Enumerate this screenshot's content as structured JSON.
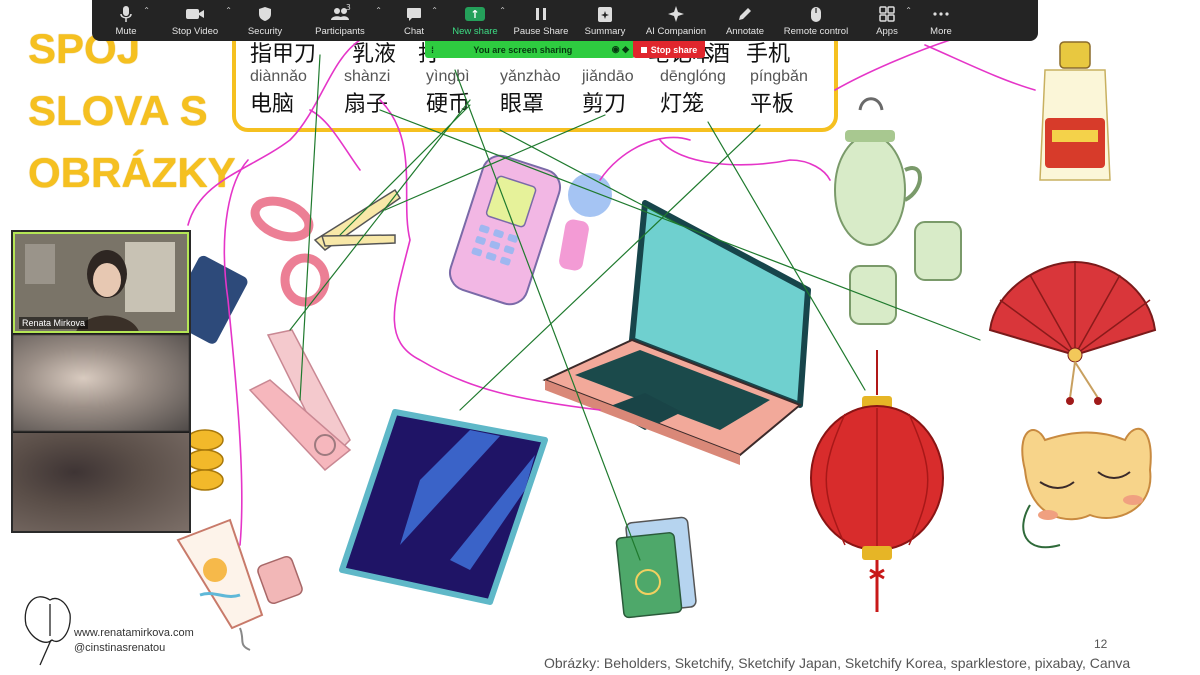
{
  "toolbar": {
    "items": [
      {
        "label": "Mute"
      },
      {
        "label": "Stop Video"
      },
      {
        "label": "Security"
      },
      {
        "label": "Participants",
        "count": "3"
      },
      {
        "label": "Chat"
      },
      {
        "label": "New share"
      },
      {
        "label": "Pause Share"
      },
      {
        "label": "Summary"
      },
      {
        "label": "AI Companion"
      },
      {
        "label": "Annotate"
      },
      {
        "label": "Remote control"
      },
      {
        "label": "Apps"
      },
      {
        "label": "More"
      }
    ]
  },
  "sharing": {
    "banner_text": "You are screen sharing",
    "stop_label": "Stop share"
  },
  "slide": {
    "title_lines": [
      "SPOJ",
      "SLOVA S",
      "OBRÁZKY"
    ],
    "words_top": [
      "指甲刀",
      "乳液",
      "打",
      "笔记本",
      "酒",
      "手机"
    ],
    "words_bottom": [
      {
        "pinyin": "diànnǎo",
        "hanzi": "电脑"
      },
      {
        "pinyin": "shànzi",
        "hanzi": "扇子"
      },
      {
        "pinyin": "yìngbì",
        "hanzi": "硬币"
      },
      {
        "pinyin": "yǎnzhào",
        "hanzi": "眼罩"
      },
      {
        "pinyin": "jiǎndāo",
        "hanzi": "剪刀"
      },
      {
        "pinyin": "dēnglóng",
        "hanzi": "灯笼"
      },
      {
        "pinyin": "píngbǎn",
        "hanzi": "平板"
      }
    ],
    "footer_web": "www.renatamirkova.com",
    "footer_handle": "@cinstinasrenatou",
    "page_number": "12",
    "credits": "Obrázky: Beholders, Sketchify, Sketchify Japan, Sketchify Korea, sparklestore, pixabay, Canva"
  },
  "participants": {
    "names": [
      "Renata Mirkova"
    ]
  },
  "colors": {
    "title": "#f5c020",
    "toolbar_bg": "#242424",
    "share_green": "#2ecc40",
    "stop_red": "#e0262d",
    "annotation_magenta": "#e535c8",
    "annotation_green": "#1f7a2e"
  },
  "icons": [
    "mic-icon",
    "video-icon",
    "shield-icon",
    "participants-icon",
    "chat-icon",
    "new-share-icon",
    "pause-icon",
    "summary-icon",
    "ai-sparkle-icon",
    "pen-icon",
    "mouse-icon",
    "apps-icon",
    "more-dots-icon",
    "ginkgo-logo-icon"
  ]
}
